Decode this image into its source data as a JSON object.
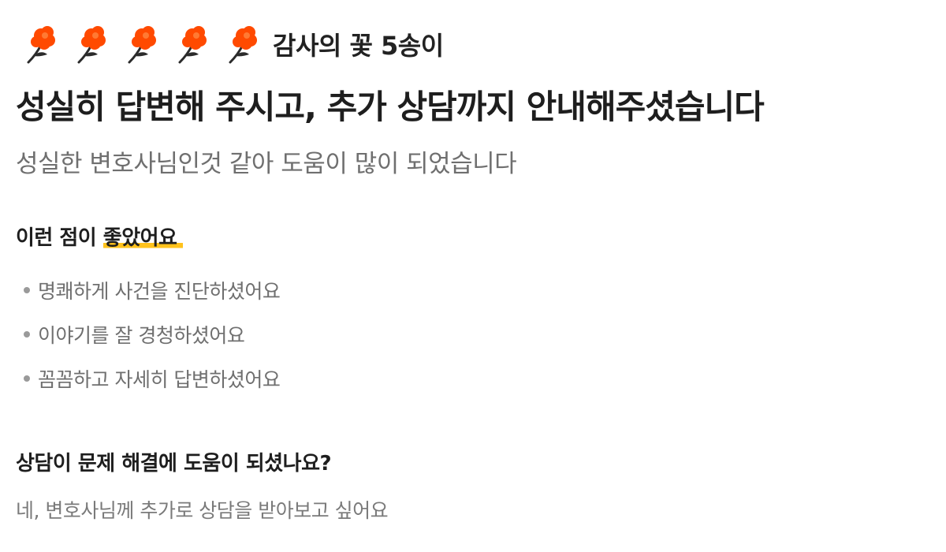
{
  "review": {
    "flowers": {
      "count": 5,
      "icon": "rose-icon",
      "color": "#ff4a00",
      "label": "감사의 꽃 5송이"
    },
    "title": "성실히 답변해 주시고, 추가 상담까지 안내해주셨습니다",
    "body": "성실한 변호사님인것 같아 도움이 많이 되었습니다",
    "good_points": {
      "heading_prefix": "이런 점이",
      "heading_highlight": "좋았어요",
      "highlight_color": "#ffc21c",
      "items": [
        "명쾌하게 사건을 진단하셨어요",
        "이야기를 잘 경청하셨어요",
        "꼼꼼하고 자세히 답변하셨어요"
      ]
    },
    "help": {
      "question": "상담이 문제 해결에 도움이 되셨나요?",
      "answer": "네, 변호사님께 추가로 상담을 받아보고 싶어요"
    }
  }
}
